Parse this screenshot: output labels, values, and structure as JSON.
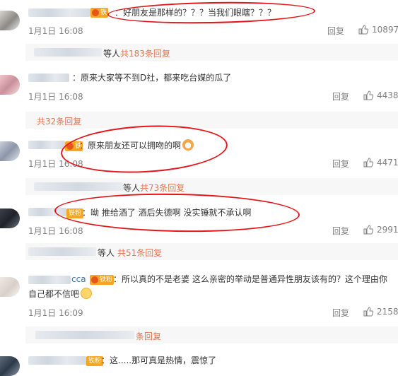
{
  "comments": [
    {
      "badge": "铁",
      "colon": "：",
      "text": "好朋友是那样的？？？当我们眼瞎？？？",
      "time": "1月1日 16:08",
      "reply": "回复",
      "likes": "10897"
    },
    {
      "text": "原来大家等不到D社，都来吃台媒的瓜了",
      "time": "1月1日 16:08",
      "reply": "回复",
      "likes": "4438"
    },
    {
      "badge": "铁",
      "text": "原来朋友还可以拥吻的啊",
      "time": "1月1日 16:08",
      "reply": "回复",
      "likes": "4471"
    },
    {
      "badge": "铁粉",
      "text": "：呦 推给酒了 酒后失德啊   没实锤就不承认啊",
      "time": "1月1日 16:08",
      "reply": "回复",
      "likes": "2991"
    },
    {
      "name_tail": "cca",
      "badge": "铁粉",
      "text": "：所以真的不是老婆 这么亲密的举动是普通异性朋友该有的？这个理由你",
      "text2": "自己都不信吧",
      "time": "1月1日 16:09",
      "reply": "回复",
      "likes": "2158"
    },
    {
      "badge": "铁粉",
      "text": "：这.....那可真是热情，震惊了"
    }
  ],
  "subreplies": [
    {
      "prefix": "等人",
      "count": "共183条回复"
    },
    {
      "count": "共32条回复"
    },
    {
      "prefix": "等人",
      "count": "共73条回复"
    },
    {
      "prefix": "等人",
      "count": "共51条回复"
    },
    {
      "count": "条回复"
    }
  ],
  "colors": {
    "accent": "#eb7350",
    "annotation": "#e5161a",
    "badge": "#f5a623"
  }
}
